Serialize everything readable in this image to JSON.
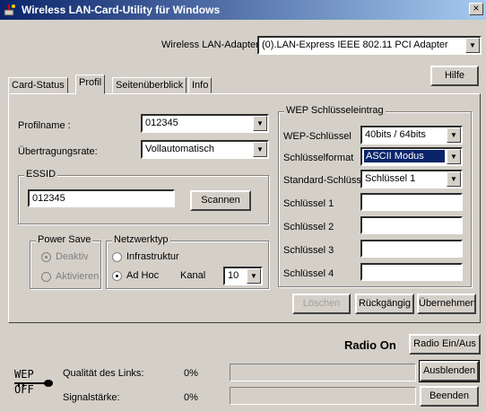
{
  "window": {
    "title": "Wireless LAN-Card-Utility für Windows",
    "close": "×"
  },
  "adapter": {
    "label": "Wireless LAN-Adapter",
    "value": "(0).LAN-Express IEEE 802.11 PCI Adapter"
  },
  "help_button": "Hilfe",
  "tabs": [
    "Card-Status",
    "Profil",
    "Seitenüberblick",
    "Info"
  ],
  "profile": {
    "name_label": "Profilname :",
    "name_value": "012345",
    "rate_label": "Übertragungsrate:",
    "rate_value": "Vollautomatisch"
  },
  "essid": {
    "group": "ESSID",
    "value": "012345",
    "scan_button": "Scannen"
  },
  "power": {
    "group": "Power Save",
    "off": "Deaktiv",
    "on": "Aktivieren"
  },
  "network": {
    "group": "Netzwerktyp",
    "infra": "Infrastruktur",
    "adhoc": "Ad Hoc",
    "channel_label": "Kanal",
    "channel_value": "10"
  },
  "wep": {
    "group": "WEP Schlüsseleintrag",
    "key_label": "WEP-Schlüssel",
    "key_value": "40bits / 64bits",
    "format_label": "Schlüsselformat",
    "format_value": "ASCII Modus",
    "default_label": "Standard-Schlüsse",
    "default_value": "Schlüssel 1",
    "key1": "Schlüssel 1",
    "key2": "Schlüssel 2",
    "key3": "Schlüssel 3",
    "key4": "Schlüssel 4"
  },
  "buttons": {
    "delete": "Löschen",
    "undo": "Rückgängig",
    "apply": "Übernehmen"
  },
  "status": {
    "radio": "Radio On",
    "radio_toggle": "Radio Ein/Aus",
    "hide": "Ausblenden",
    "exit": "Beenden",
    "quality_label": "Qualität des Links:",
    "quality_value": "0%",
    "signal_label": "Signalstärke:",
    "signal_value": "0%",
    "logo_top": "WEP",
    "logo_bottom": "OFF"
  },
  "progress": {
    "quality": 0,
    "signal": 0
  },
  "colors": {
    "title_start": "#0a246a",
    "title_end": "#a6caf0",
    "selection": "#0a246a"
  }
}
